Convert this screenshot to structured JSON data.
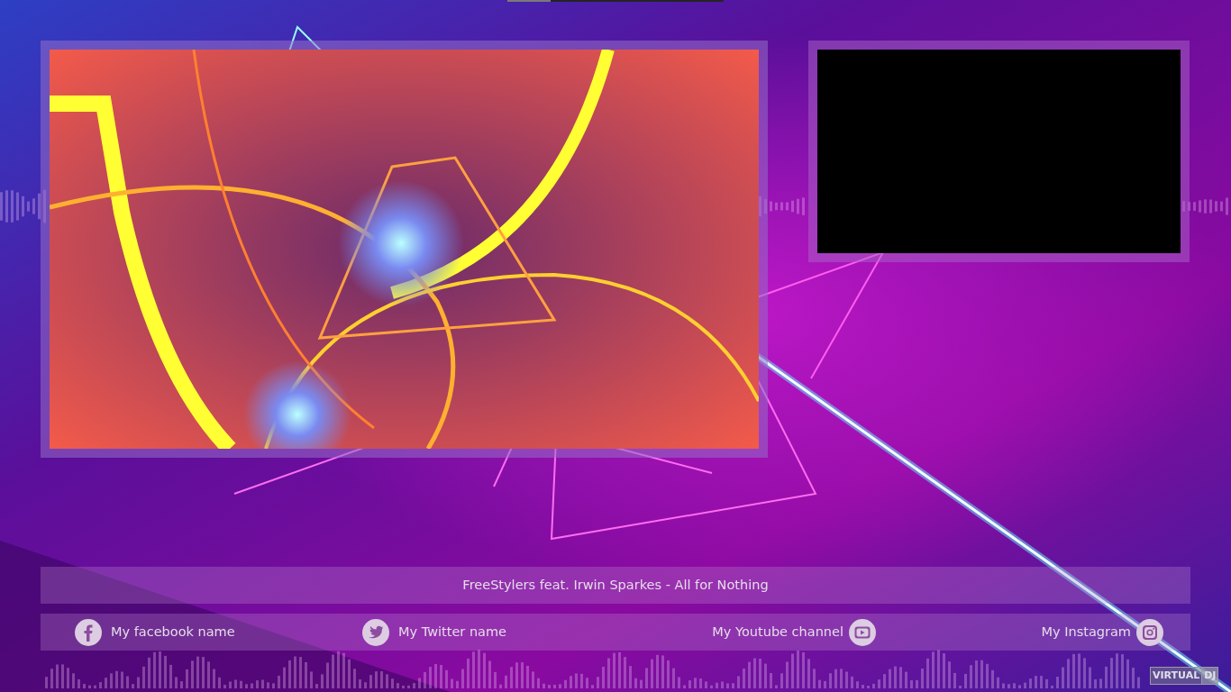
{
  "progress": {
    "level": 0.2
  },
  "preview_video": {
    "kind": "blank"
  },
  "now_playing": "FreeStylers feat. Irwin Sparkes - All for Nothing",
  "social": [
    {
      "kind": "facebook",
      "label": "My facebook name"
    },
    {
      "kind": "twitter",
      "label": "My Twitter name"
    },
    {
      "kind": "youtube",
      "label": "My Youtube channel"
    },
    {
      "kind": "instagram",
      "label": "My Instagram"
    }
  ],
  "logo": [
    "VIRTUAL",
    "DJ"
  ]
}
